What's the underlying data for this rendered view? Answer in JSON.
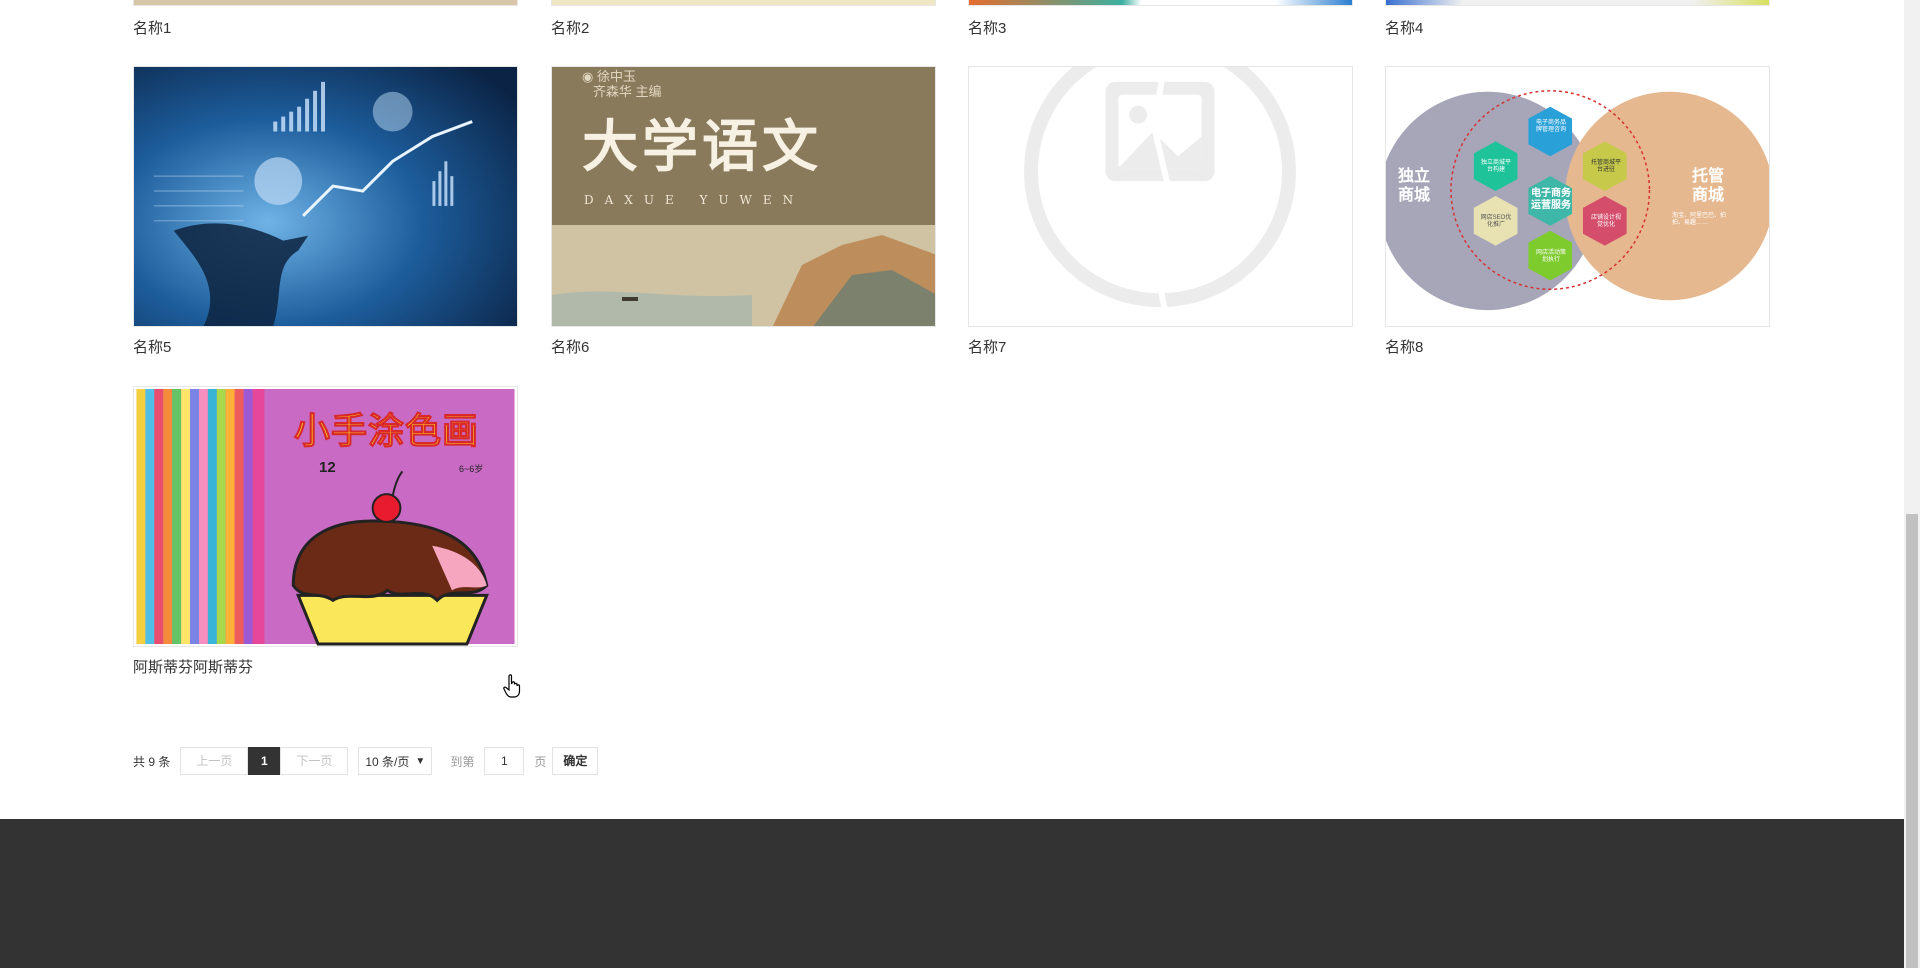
{
  "cards_top": [
    "名称1",
    "名称2",
    "名称3",
    "名称4"
  ],
  "cards_mid": [
    {
      "name": "名称5"
    },
    {
      "name": "名称6",
      "editors": "徐中玉",
      "editors2": "齐森华",
      "chief": "主编",
      "title": "大学语文",
      "subtitle": "DAXUE YUWEN"
    },
    {
      "name": "名称7"
    },
    {
      "name": "名称8",
      "left_label": "独立商城",
      "right_label": "托管商城",
      "center": "电子商务运营服务",
      "hex": [
        "电子商务品牌管理咨询",
        "独立商城平台构建",
        "托管商城平台进驻",
        "网店SEO优化推广",
        "店铺设计视觉优化",
        "网店活动策划执行"
      ],
      "right_note": "淘宝、阿里巴巴、拍拍、易趣……"
    }
  ],
  "cards_bottom": [
    {
      "name": "阿斯蒂芬阿斯蒂芬",
      "book_title": "小手涂色画",
      "book_no": "12",
      "book_age": "6~6岁"
    }
  ],
  "pager": {
    "total": "共 9 条",
    "prev": "上一页",
    "current": "1",
    "next": "下一页",
    "size": "10 条/页",
    "goto": "到第",
    "page_value": "1",
    "page_suffix": "页",
    "confirm": "确定"
  },
  "colors": {
    "footer": "#333333",
    "accent_dark": "#333333"
  }
}
